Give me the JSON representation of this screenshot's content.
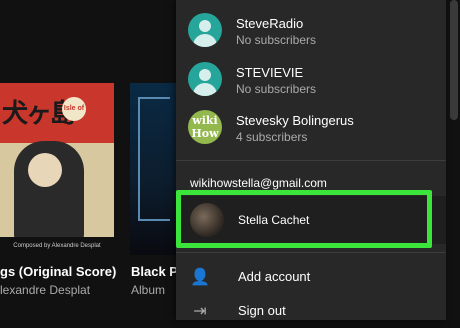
{
  "background": {
    "card1": {
      "title": "gs (Original Score)",
      "subtitle": "lexandre Desplat",
      "art_glyph": "犬ヶ島",
      "art_badge": "Isle of Dogs",
      "art_credit": "Composed by Alexandre Desplat"
    },
    "card2": {
      "title": "Black Pa",
      "subtitle": "Album"
    }
  },
  "account_panel": {
    "channels": [
      {
        "name": "SteveRadio",
        "subs": "No subscribers",
        "avatar": "default-avatar-icon"
      },
      {
        "name": "STEVIEVIE",
        "subs": "No subscribers",
        "avatar": "default-avatar-icon"
      },
      {
        "name": "Stevesky Bolingerus",
        "subs": "4 subscribers",
        "avatar_text": "wiki How"
      }
    ],
    "email": "wikihowstella@gmail.com",
    "selected_account": "Stella Cachet",
    "menu": [
      {
        "label": "Add account",
        "icon": "add-person-icon",
        "glyph": "👤"
      },
      {
        "label": "Sign out",
        "icon": "sign-out-icon",
        "glyph": "⇥"
      }
    ]
  },
  "colors": {
    "highlight": "#3ce53c",
    "panel": "#282828",
    "teal_avatar": "#26a69a"
  }
}
